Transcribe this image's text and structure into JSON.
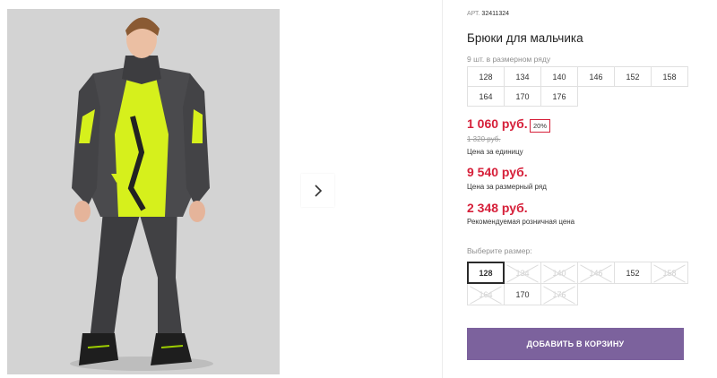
{
  "product": {
    "sku_label": "АРТ.",
    "sku": "32411324",
    "title": "Брюки для мальчика",
    "pack_info": "9 шт. в размерном ряду",
    "pack_sizes": [
      "128",
      "134",
      "140",
      "146",
      "152",
      "158",
      "164",
      "170",
      "176"
    ]
  },
  "pricing": {
    "unit_price": "1 060 руб.",
    "discount_badge": "20%",
    "old_price": "1 320 руб.",
    "unit_label": "Цена за единицу",
    "row_price": "9 540 руб.",
    "row_label": "Цена за размерный ряд",
    "retail_price": "2 348 руб.",
    "retail_label": "Рекомендуемая розничная цена",
    "accent_color": "#d6203a"
  },
  "size_picker": {
    "label": "Выберите размер:",
    "selected": "128",
    "options": [
      {
        "label": "128",
        "state": "selected"
      },
      {
        "label": "134",
        "state": "disabled"
      },
      {
        "label": "140",
        "state": "disabled"
      },
      {
        "label": "146",
        "state": "disabled"
      },
      {
        "label": "152",
        "state": "available"
      },
      {
        "label": "158",
        "state": "disabled"
      },
      {
        "label": "164",
        "state": "disabled"
      },
      {
        "label": "170",
        "state": "available"
      },
      {
        "label": "176",
        "state": "disabled"
      }
    ]
  },
  "cart_button": {
    "label": "ДОБАВИТЬ В КОРЗИНУ",
    "color": "#7c629d"
  },
  "gallery": {
    "next_icon": "chevron-right-icon"
  }
}
